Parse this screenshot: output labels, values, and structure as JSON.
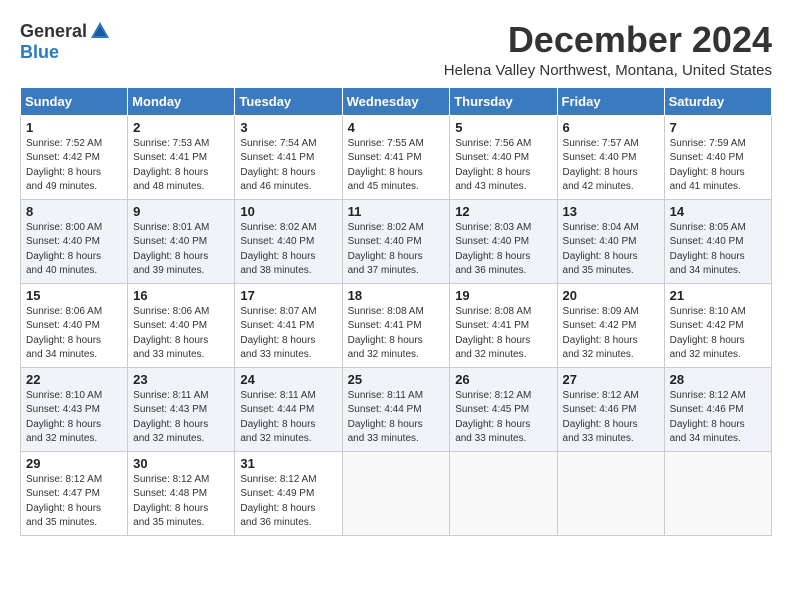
{
  "logo": {
    "general": "General",
    "blue": "Blue"
  },
  "title": "December 2024",
  "location": "Helena Valley Northwest, Montana, United States",
  "days_of_week": [
    "Sunday",
    "Monday",
    "Tuesday",
    "Wednesday",
    "Thursday",
    "Friday",
    "Saturday"
  ],
  "weeks": [
    [
      {
        "day": "1",
        "lines": [
          "Sunrise: 7:52 AM",
          "Sunset: 4:42 PM",
          "Daylight: 8 hours",
          "and 49 minutes."
        ]
      },
      {
        "day": "2",
        "lines": [
          "Sunrise: 7:53 AM",
          "Sunset: 4:41 PM",
          "Daylight: 8 hours",
          "and 48 minutes."
        ]
      },
      {
        "day": "3",
        "lines": [
          "Sunrise: 7:54 AM",
          "Sunset: 4:41 PM",
          "Daylight: 8 hours",
          "and 46 minutes."
        ]
      },
      {
        "day": "4",
        "lines": [
          "Sunrise: 7:55 AM",
          "Sunset: 4:41 PM",
          "Daylight: 8 hours",
          "and 45 minutes."
        ]
      },
      {
        "day": "5",
        "lines": [
          "Sunrise: 7:56 AM",
          "Sunset: 4:40 PM",
          "Daylight: 8 hours",
          "and 43 minutes."
        ]
      },
      {
        "day": "6",
        "lines": [
          "Sunrise: 7:57 AM",
          "Sunset: 4:40 PM",
          "Daylight: 8 hours",
          "and 42 minutes."
        ]
      },
      {
        "day": "7",
        "lines": [
          "Sunrise: 7:59 AM",
          "Sunset: 4:40 PM",
          "Daylight: 8 hours",
          "and 41 minutes."
        ]
      }
    ],
    [
      {
        "day": "8",
        "lines": [
          "Sunrise: 8:00 AM",
          "Sunset: 4:40 PM",
          "Daylight: 8 hours",
          "and 40 minutes."
        ]
      },
      {
        "day": "9",
        "lines": [
          "Sunrise: 8:01 AM",
          "Sunset: 4:40 PM",
          "Daylight: 8 hours",
          "and 39 minutes."
        ]
      },
      {
        "day": "10",
        "lines": [
          "Sunrise: 8:02 AM",
          "Sunset: 4:40 PM",
          "Daylight: 8 hours",
          "and 38 minutes."
        ]
      },
      {
        "day": "11",
        "lines": [
          "Sunrise: 8:02 AM",
          "Sunset: 4:40 PM",
          "Daylight: 8 hours",
          "and 37 minutes."
        ]
      },
      {
        "day": "12",
        "lines": [
          "Sunrise: 8:03 AM",
          "Sunset: 4:40 PM",
          "Daylight: 8 hours",
          "and 36 minutes."
        ]
      },
      {
        "day": "13",
        "lines": [
          "Sunrise: 8:04 AM",
          "Sunset: 4:40 PM",
          "Daylight: 8 hours",
          "and 35 minutes."
        ]
      },
      {
        "day": "14",
        "lines": [
          "Sunrise: 8:05 AM",
          "Sunset: 4:40 PM",
          "Daylight: 8 hours",
          "and 34 minutes."
        ]
      }
    ],
    [
      {
        "day": "15",
        "lines": [
          "Sunrise: 8:06 AM",
          "Sunset: 4:40 PM",
          "Daylight: 8 hours",
          "and 34 minutes."
        ]
      },
      {
        "day": "16",
        "lines": [
          "Sunrise: 8:06 AM",
          "Sunset: 4:40 PM",
          "Daylight: 8 hours",
          "and 33 minutes."
        ]
      },
      {
        "day": "17",
        "lines": [
          "Sunrise: 8:07 AM",
          "Sunset: 4:41 PM",
          "Daylight: 8 hours",
          "and 33 minutes."
        ]
      },
      {
        "day": "18",
        "lines": [
          "Sunrise: 8:08 AM",
          "Sunset: 4:41 PM",
          "Daylight: 8 hours",
          "and 32 minutes."
        ]
      },
      {
        "day": "19",
        "lines": [
          "Sunrise: 8:08 AM",
          "Sunset: 4:41 PM",
          "Daylight: 8 hours",
          "and 32 minutes."
        ]
      },
      {
        "day": "20",
        "lines": [
          "Sunrise: 8:09 AM",
          "Sunset: 4:42 PM",
          "Daylight: 8 hours",
          "and 32 minutes."
        ]
      },
      {
        "day": "21",
        "lines": [
          "Sunrise: 8:10 AM",
          "Sunset: 4:42 PM",
          "Daylight: 8 hours",
          "and 32 minutes."
        ]
      }
    ],
    [
      {
        "day": "22",
        "lines": [
          "Sunrise: 8:10 AM",
          "Sunset: 4:43 PM",
          "Daylight: 8 hours",
          "and 32 minutes."
        ]
      },
      {
        "day": "23",
        "lines": [
          "Sunrise: 8:11 AM",
          "Sunset: 4:43 PM",
          "Daylight: 8 hours",
          "and 32 minutes."
        ]
      },
      {
        "day": "24",
        "lines": [
          "Sunrise: 8:11 AM",
          "Sunset: 4:44 PM",
          "Daylight: 8 hours",
          "and 32 minutes."
        ]
      },
      {
        "day": "25",
        "lines": [
          "Sunrise: 8:11 AM",
          "Sunset: 4:44 PM",
          "Daylight: 8 hours",
          "and 33 minutes."
        ]
      },
      {
        "day": "26",
        "lines": [
          "Sunrise: 8:12 AM",
          "Sunset: 4:45 PM",
          "Daylight: 8 hours",
          "and 33 minutes."
        ]
      },
      {
        "day": "27",
        "lines": [
          "Sunrise: 8:12 AM",
          "Sunset: 4:46 PM",
          "Daylight: 8 hours",
          "and 33 minutes."
        ]
      },
      {
        "day": "28",
        "lines": [
          "Sunrise: 8:12 AM",
          "Sunset: 4:46 PM",
          "Daylight: 8 hours",
          "and 34 minutes."
        ]
      }
    ],
    [
      {
        "day": "29",
        "lines": [
          "Sunrise: 8:12 AM",
          "Sunset: 4:47 PM",
          "Daylight: 8 hours",
          "and 35 minutes."
        ]
      },
      {
        "day": "30",
        "lines": [
          "Sunrise: 8:12 AM",
          "Sunset: 4:48 PM",
          "Daylight: 8 hours",
          "and 35 minutes."
        ]
      },
      {
        "day": "31",
        "lines": [
          "Sunrise: 8:12 AM",
          "Sunset: 4:49 PM",
          "Daylight: 8 hours",
          "and 36 minutes."
        ]
      },
      null,
      null,
      null,
      null
    ]
  ]
}
